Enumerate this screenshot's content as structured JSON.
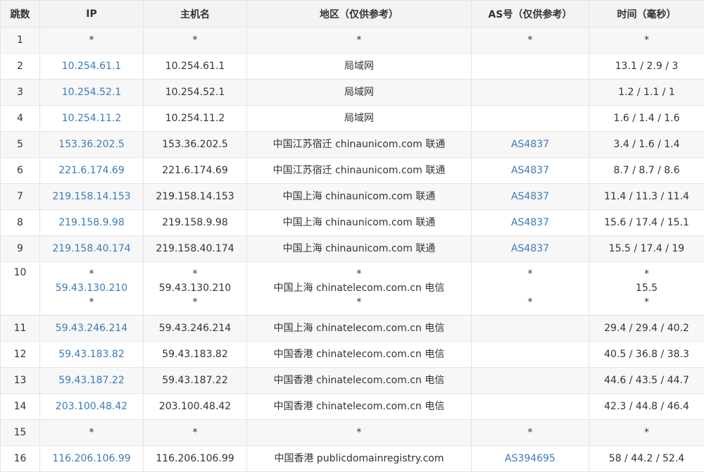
{
  "headers": [
    "跳数",
    "IP",
    "主机名",
    "地区（仅供参考）",
    "AS号（仅供参考）",
    "时间（毫秒）"
  ],
  "rows": [
    {
      "hop": "1",
      "ip": [
        "*"
      ],
      "host": [
        "*"
      ],
      "region": [
        "*"
      ],
      "as": [
        "*"
      ],
      "time": [
        "*"
      ]
    },
    {
      "hop": "2",
      "ip": [
        "10.254.61.1"
      ],
      "host": [
        "10.254.61.1"
      ],
      "region": [
        "局域网"
      ],
      "as": [
        ""
      ],
      "time": [
        "13.1 / 2.9 / 3"
      ]
    },
    {
      "hop": "3",
      "ip": [
        "10.254.52.1"
      ],
      "host": [
        "10.254.52.1"
      ],
      "region": [
        "局域网"
      ],
      "as": [
        ""
      ],
      "time": [
        "1.2 / 1.1 / 1"
      ]
    },
    {
      "hop": "4",
      "ip": [
        "10.254.11.2"
      ],
      "host": [
        "10.254.11.2"
      ],
      "region": [
        "局域网"
      ],
      "as": [
        ""
      ],
      "time": [
        "1.6 / 1.4 / 1.6"
      ]
    },
    {
      "hop": "5",
      "ip": [
        "153.36.202.5"
      ],
      "host": [
        "153.36.202.5"
      ],
      "region": [
        "中国江苏宿迁 chinaunicom.com 联通"
      ],
      "as": [
        "AS4837"
      ],
      "time": [
        "3.4 / 1.6 / 1.4"
      ]
    },
    {
      "hop": "6",
      "ip": [
        "221.6.174.69"
      ],
      "host": [
        "221.6.174.69"
      ],
      "region": [
        "中国江苏宿迁 chinaunicom.com 联通"
      ],
      "as": [
        "AS4837"
      ],
      "time": [
        "8.7 / 8.7 / 8.6"
      ]
    },
    {
      "hop": "7",
      "ip": [
        "219.158.14.153"
      ],
      "host": [
        "219.158.14.153"
      ],
      "region": [
        "中国上海 chinaunicom.com 联通"
      ],
      "as": [
        "AS4837"
      ],
      "time": [
        "11.4 / 11.3 / 11.4"
      ]
    },
    {
      "hop": "8",
      "ip": [
        "219.158.9.98"
      ],
      "host": [
        "219.158.9.98"
      ],
      "region": [
        "中国上海 chinaunicom.com 联通"
      ],
      "as": [
        "AS4837"
      ],
      "time": [
        "15.6 / 17.4 / 15.1"
      ]
    },
    {
      "hop": "9",
      "ip": [
        "219.158.40.174"
      ],
      "host": [
        "219.158.40.174"
      ],
      "region": [
        "中国上海 chinaunicom.com 联通"
      ],
      "as": [
        "AS4837"
      ],
      "time": [
        "15.5 / 17.4 / 19"
      ]
    },
    {
      "hop": "10",
      "ip": [
        "*",
        "59.43.130.210",
        "*"
      ],
      "host": [
        "*",
        "59.43.130.210",
        "*"
      ],
      "region": [
        "*",
        "中国上海 chinatelecom.com.cn 电信",
        "*"
      ],
      "as": [
        "*",
        "",
        "*"
      ],
      "time": [
        "*",
        "15.5",
        "*"
      ]
    },
    {
      "hop": "11",
      "ip": [
        "59.43.246.214"
      ],
      "host": [
        "59.43.246.214"
      ],
      "region": [
        "中国上海 chinatelecom.com.cn 电信"
      ],
      "as": [
        ""
      ],
      "time": [
        "29.4 / 29.4 / 40.2"
      ]
    },
    {
      "hop": "12",
      "ip": [
        "59.43.183.82"
      ],
      "host": [
        "59.43.183.82"
      ],
      "region": [
        "中国香港 chinatelecom.com.cn 电信"
      ],
      "as": [
        ""
      ],
      "time": [
        "40.5 / 36.8 / 38.3"
      ]
    },
    {
      "hop": "13",
      "ip": [
        "59.43.187.22"
      ],
      "host": [
        "59.43.187.22"
      ],
      "region": [
        "中国香港 chinatelecom.com.cn 电信"
      ],
      "as": [
        ""
      ],
      "time": [
        "44.6 / 43.5 / 44.7"
      ]
    },
    {
      "hop": "14",
      "ip": [
        "203.100.48.42"
      ],
      "host": [
        "203.100.48.42"
      ],
      "region": [
        "中国香港 chinatelecom.com.cn 电信"
      ],
      "as": [
        ""
      ],
      "time": [
        "42.3 / 44.8 / 46.4"
      ]
    },
    {
      "hop": "15",
      "ip": [
        "*"
      ],
      "host": [
        "*"
      ],
      "region": [
        "*"
      ],
      "as": [
        "*"
      ],
      "time": [
        "*"
      ]
    },
    {
      "hop": "16",
      "ip": [
        "116.206.106.99"
      ],
      "host": [
        "116.206.106.99"
      ],
      "region": [
        "中国香港 publicdomainregistry.com"
      ],
      "as": [
        "AS394695"
      ],
      "time": [
        "58 / 44.2 / 52.4"
      ]
    }
  ]
}
